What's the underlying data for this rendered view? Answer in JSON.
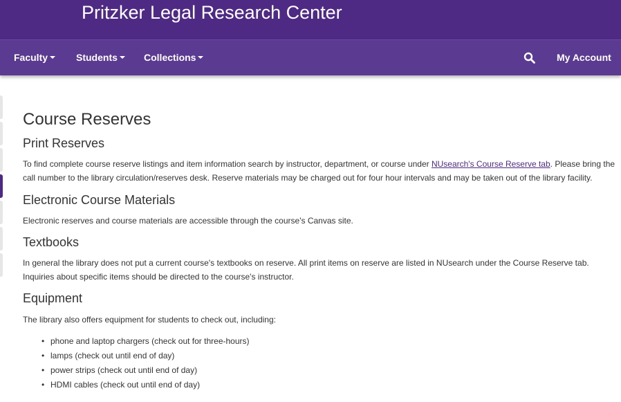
{
  "banner": {
    "title": "Pritzker Legal Research Center"
  },
  "nav": {
    "items": [
      {
        "label": "Faculty"
      },
      {
        "label": "Students"
      },
      {
        "label": "Collections"
      }
    ],
    "search_icon": "search-icon",
    "account_label": "My Account"
  },
  "side_tabs": {
    "count": 7,
    "active_index": 3
  },
  "page": {
    "title": "Course Reserves",
    "sections": {
      "print": {
        "heading": "Print Reserves",
        "text_before": "To find complete course reserve listings and item information search by instructor, department, or course under ",
        "link": "NUsearch's Course Reserve tab",
        "text_after": ". Please bring the call number to the library circulation/reserves desk. Reserve materials may be charged out for four hour intervals and may be taken out of the library facility."
      },
      "electronic": {
        "heading": "Electronic Course Materials",
        "text": "Electronic reserves and course materials are accessible through the course's Canvas site."
      },
      "textbooks": {
        "heading": "Textbooks",
        "text": "In general the library does not put a current course's textbooks on reserve. All print items on reserve are listed in NUsearch under the Course Reserve tab. Inquiries about specific items should be directed to the course's instructor."
      },
      "equipment": {
        "heading": "Equipment",
        "text": "The library also offers equipment for students to check out, including:",
        "items": [
          "phone and laptop chargers (check out for three-hours)",
          "lamps (check out until end of day)",
          "power strips (check out until end of day)",
          "HDMI cables (check out until end of day)"
        ]
      }
    }
  },
  "colors": {
    "brand": "#4e2a84",
    "nav": "#5b3a92",
    "text": "#333333"
  }
}
